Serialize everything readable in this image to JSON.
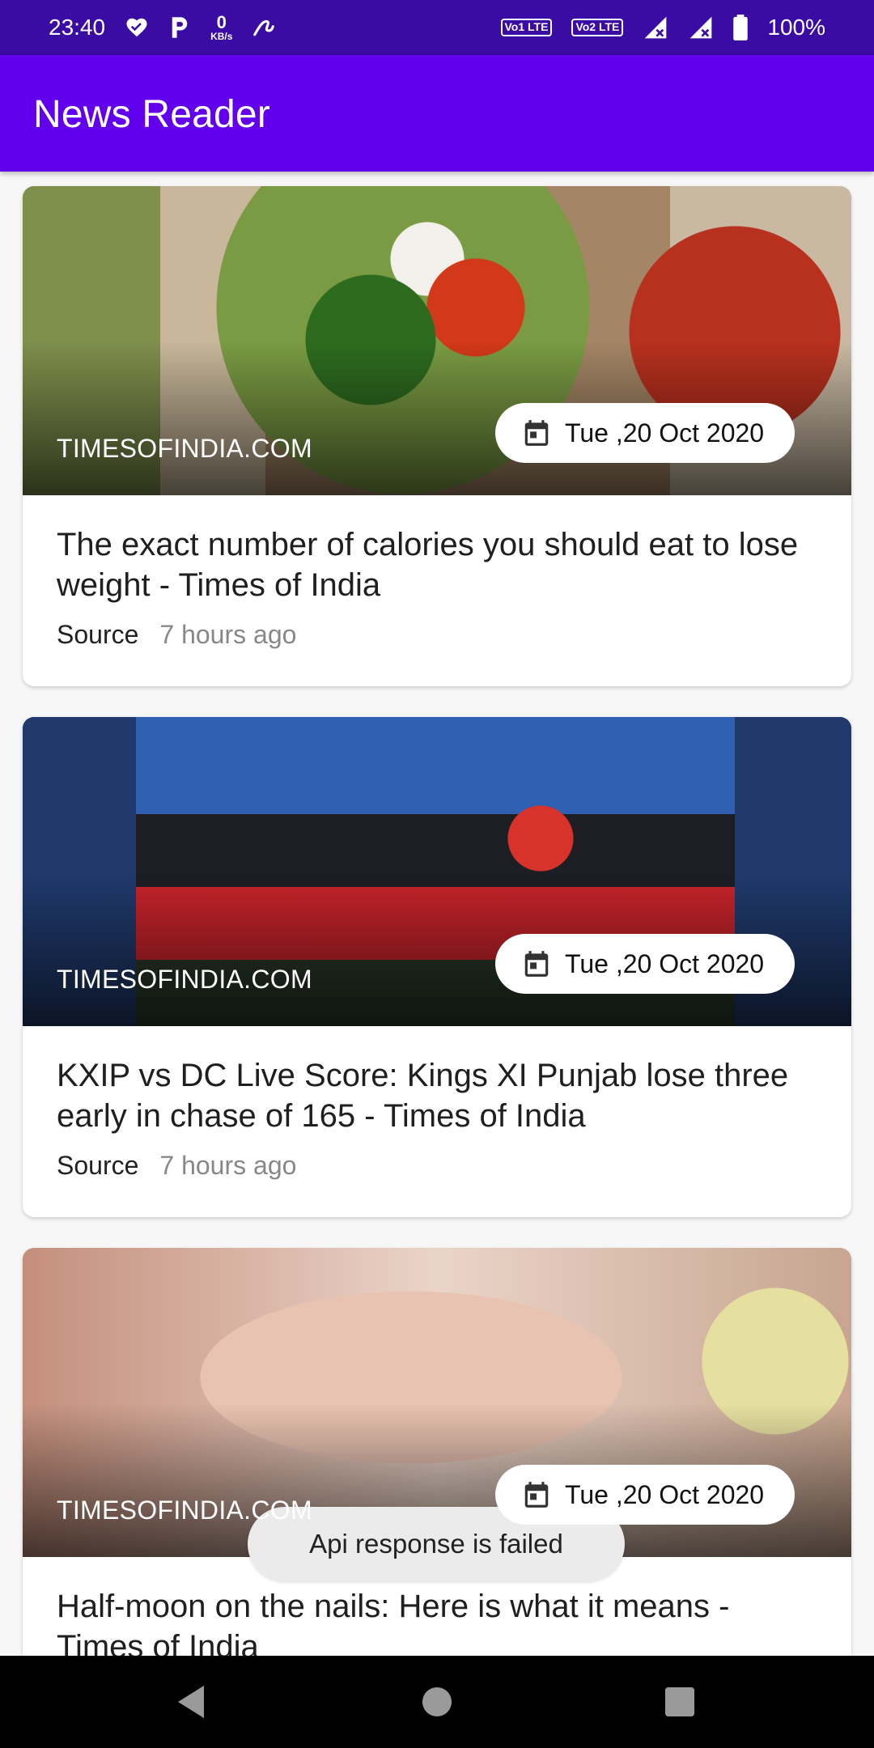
{
  "status_bar": {
    "time": "23:40",
    "network_speed_value": "0",
    "network_speed_unit": "KB/s",
    "volte1": "Vo1 LTE",
    "volte2": "Vo2 LTE",
    "battery": "100%",
    "icons": [
      "heart-icon",
      "paytm-p-icon",
      "swirl-icon",
      "signal-icon",
      "signal-icon",
      "battery-icon"
    ]
  },
  "app_bar": {
    "title": "News Reader",
    "color": "#6200ee"
  },
  "articles": [
    {
      "domain": "TIMESOFINDIA.COM",
      "date": "Tue ,20 Oct 2020",
      "title": "The exact number of calories you should eat to lose weight - Times of India",
      "source_label": "Source",
      "time_ago": "7 hours ago"
    },
    {
      "domain": "TIMESOFINDIA.COM",
      "date": "Tue ,20 Oct 2020",
      "title": "KXIP vs DC Live Score: Kings XI Punjab lose three early in chase of 165 - Times of India",
      "source_label": "Source",
      "time_ago": "7 hours ago"
    },
    {
      "domain": "TIMESOFINDIA.COM",
      "date": "Tue ,20 Oct 2020",
      "title": "Half-moon on the nails: Here is what it means - Times of India",
      "source_label": "",
      "time_ago": ""
    }
  ],
  "toast": {
    "message": "Api response is failed"
  },
  "nav_bar": {
    "buttons": [
      "back-icon",
      "home-icon",
      "recents-icon"
    ]
  }
}
